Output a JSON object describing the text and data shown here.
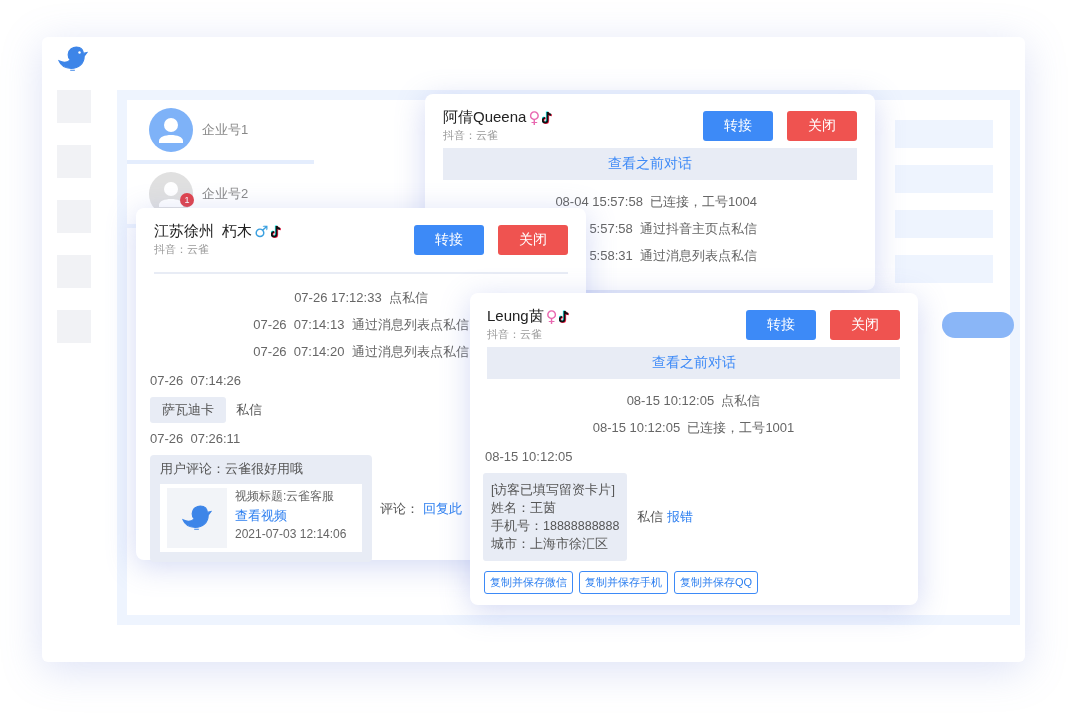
{
  "accounts": [
    {
      "name": "企业号1",
      "active": true
    },
    {
      "name": "企业号2",
      "active": false,
      "unread": "1"
    }
  ],
  "chats": [
    {
      "name": "阿倩Queena",
      "gender": {
        "symbol": "♀",
        "color": "#e868b0"
      },
      "platform": "抖音：云雀",
      "transfer_label": "转接",
      "close_label": "关闭",
      "history_label": "查看之前对话",
      "events": [
        "08-04 15:57:58  已连接，工号1004",
        "5:57:58  通过抖音主页点私信",
        "5:58:31  通过消息列表点私信"
      ]
    },
    {
      "name": "江苏徐州  朽木",
      "gender": {
        "symbol": "♂",
        "color": "#3aa0e0"
      },
      "platform": "抖音：云雀",
      "transfer_label": "转接",
      "close_label": "关闭",
      "events": [
        "07-26 17:12:33  点私信",
        "07-26  07:14:13  通过消息列表点私信",
        "07-26  07:14:20  通过消息列表点私信"
      ],
      "messages": [
        {
          "kind": "chip",
          "time": "07-26  07:14:26",
          "chip": "萨瓦迪卡",
          "text": "私信"
        },
        {
          "kind": "comment",
          "time": "07-26  07:26:11",
          "comment": "用户评论：云雀很好用哦",
          "video_title": "视频标题:云雀客服",
          "video_link": "查看视频",
          "video_date": "2021-07-03 12:14:06",
          "reply_label": "评论：",
          "reply_link": "回复此"
        }
      ]
    },
    {
      "name": "Leung茵",
      "gender": {
        "symbol": "♀",
        "color": "#e868b0"
      },
      "platform": "抖音：云雀",
      "transfer_label": "转接",
      "close_label": "关闭",
      "history_label": "查看之前对话",
      "events": [
        "08-15 10:12:05  点私信",
        "08-15 10:12:05  已连接，工号1001"
      ],
      "messages": [
        {
          "kind": "card",
          "time": "08-15 10:12:05",
          "lines": [
            "[访客已填写留资卡片]",
            "姓名：王茵",
            "手机号：18888888888",
            "城市：上海市徐汇区"
          ],
          "text": "私信",
          "link": "报错",
          "actions": [
            "复制并保存微信",
            "复制并保存手机",
            "复制并保存QQ"
          ]
        }
      ]
    }
  ]
}
